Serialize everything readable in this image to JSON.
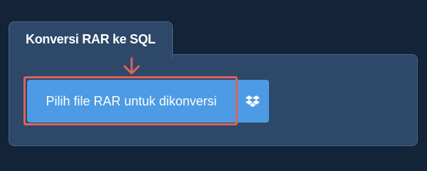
{
  "converter": {
    "tab_title": "Konversi RAR ke SQL",
    "upload_button_label": "Pilih file RAR untuk dikonversi",
    "dropbox_icon": "dropbox-icon",
    "arrow_icon": "down-arrow-icon"
  },
  "colors": {
    "page_background": "#132338",
    "panel_background": "#2d4868",
    "panel_border": "#4a6488",
    "button_background": "#4d9be4",
    "highlight": "#e0625a"
  }
}
